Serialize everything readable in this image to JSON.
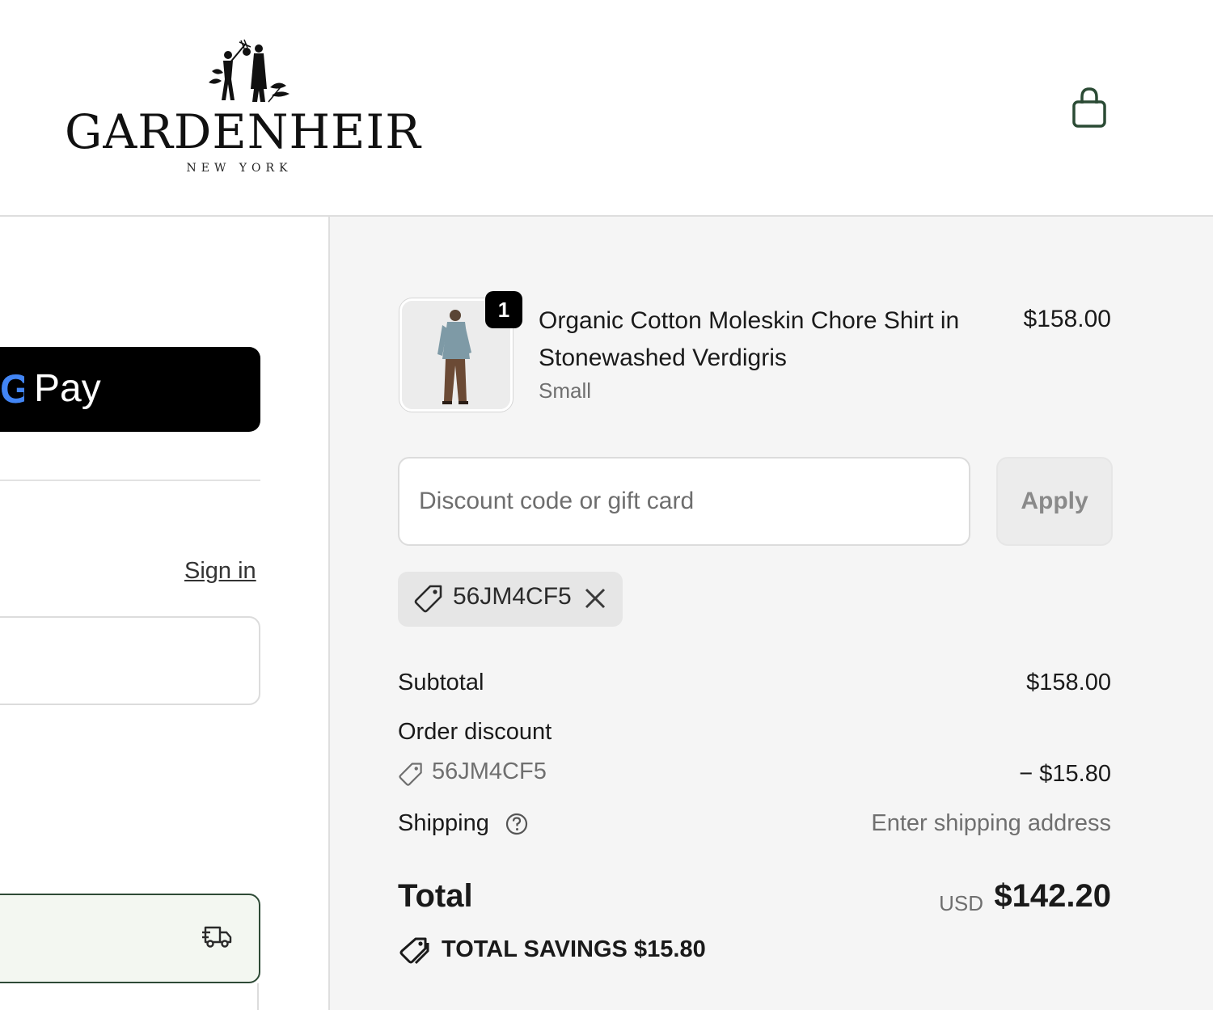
{
  "header": {
    "brand_name": "GARDENHEIR",
    "brand_location": "NEW YORK"
  },
  "express_checkout": {
    "gpay_label": "Pay"
  },
  "contact": {
    "sign_in_label": "Sign in"
  },
  "order_summary": {
    "line_items": [
      {
        "name": "Organic Cotton Moleskin Chore Shirt in Stonewashed Verdigris",
        "variant": "Small",
        "price": "$158.00",
        "quantity": "1"
      }
    ],
    "discount": {
      "placeholder": "Discount code or gift card",
      "apply_label": "Apply",
      "applied_code": "56JM4CF5"
    },
    "subtotal_label": "Subtotal",
    "subtotal_value": "$158.00",
    "order_discount_label": "Order discount",
    "order_discount_code": "56JM4CF5",
    "order_discount_value": "− $15.80",
    "shipping_label": "Shipping",
    "shipping_value": "Enter shipping address",
    "total_label": "Total",
    "total_currency": "USD",
    "total_value": "$142.20",
    "savings_label": "TOTAL SAVINGS",
    "savings_value": "$15.80"
  },
  "colors": {
    "summary_bg": "#f5f5f5",
    "button_dark": "#000000",
    "delivery_accent": "#2e4a36",
    "delivery_bg": "#f3f7f1"
  }
}
